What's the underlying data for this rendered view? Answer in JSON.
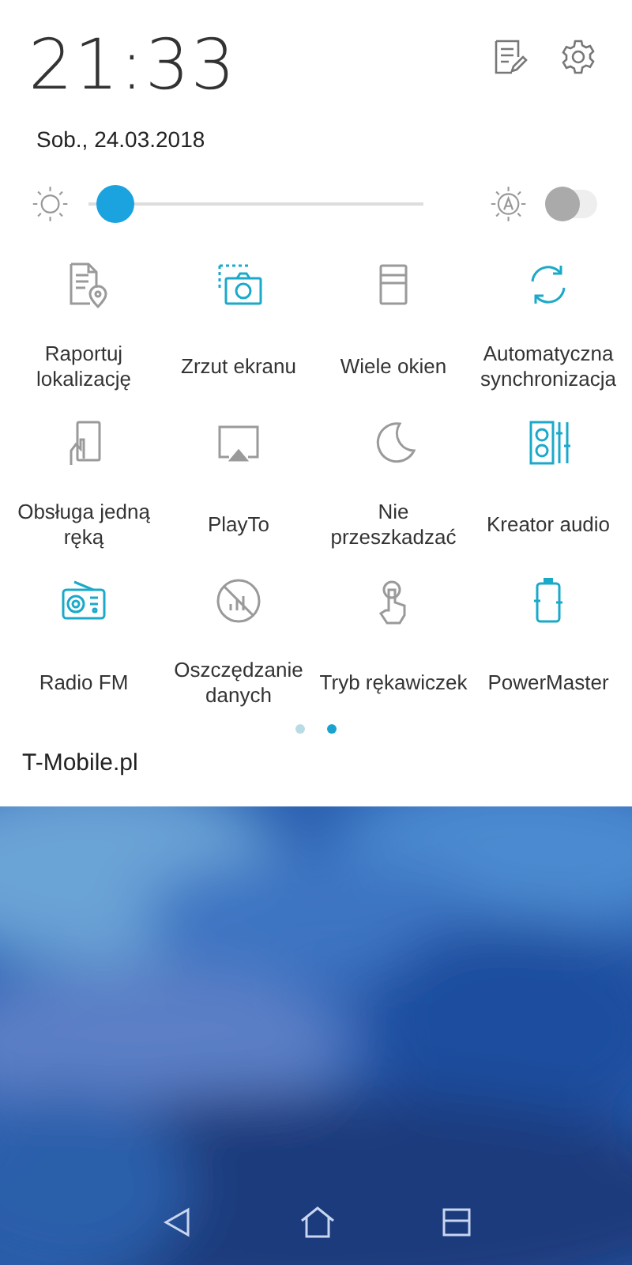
{
  "clock": {
    "time": "21:33",
    "date": "Sob., 24.03.2018"
  },
  "brightness": {
    "level": 0.03,
    "auto": false
  },
  "tiles": [
    {
      "kind": "location-report",
      "label": "Raportuj lokalizację",
      "on": false
    },
    {
      "kind": "screenshot",
      "label": "Zrzut ekranu",
      "on": true
    },
    {
      "kind": "multi-window",
      "label": "Wiele okien",
      "on": false
    },
    {
      "kind": "sync",
      "label": "Automatyczna synchronizacja",
      "on": true
    },
    {
      "kind": "one-hand",
      "label": "Obsługa jedną ręką",
      "on": false
    },
    {
      "kind": "playto",
      "label": "PlayTo",
      "on": false
    },
    {
      "kind": "moon",
      "label": "Nie przeszkadzać",
      "on": false
    },
    {
      "kind": "audio",
      "label": "Kreator audio",
      "on": true
    },
    {
      "kind": "radio",
      "label": "Radio FM",
      "on": true
    },
    {
      "kind": "data-saver",
      "label": "Oszczędzanie danych",
      "on": false
    },
    {
      "kind": "glove",
      "label": "Tryb rękawiczek",
      "on": false
    },
    {
      "kind": "battery",
      "label": "PowerMaster",
      "on": true
    }
  ],
  "pages": [
    {
      "selected": false
    },
    {
      "selected": true
    }
  ],
  "carrier": "T-Mobile.pl"
}
